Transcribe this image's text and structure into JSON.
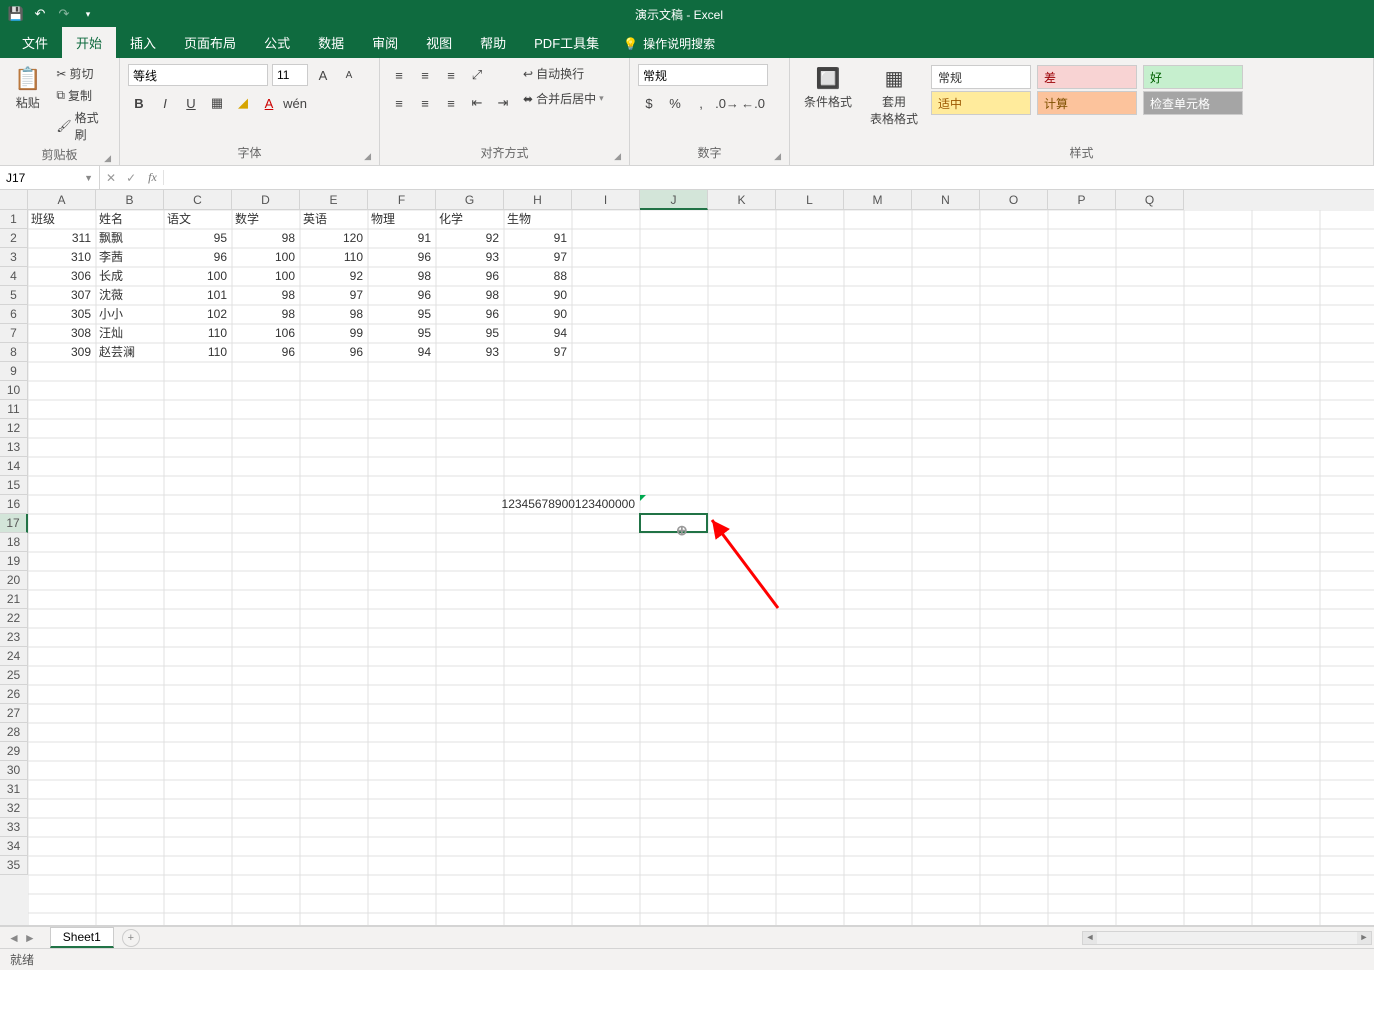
{
  "title": "演示文稿 - Excel",
  "qat": {
    "save": "save-icon",
    "undo": "undo-icon",
    "redo": "redo-icon"
  },
  "tabs": {
    "file": "文件",
    "home": "开始",
    "insert": "插入",
    "layout": "页面布局",
    "formulas": "公式",
    "data": "数据",
    "review": "审阅",
    "view": "视图",
    "help": "帮助",
    "pdf": "PDF工具集",
    "tellme": "操作说明搜索"
  },
  "ribbon": {
    "clipboard": {
      "label": "剪贴板",
      "paste": "粘贴",
      "cut": "剪切",
      "copy": "复制",
      "painter": "格式刷"
    },
    "font": {
      "label": "字体",
      "name": "等线",
      "size": "11"
    },
    "align": {
      "label": "对齐方式",
      "wrap": "自动换行",
      "merge": "合并后居中"
    },
    "number": {
      "label": "数字",
      "format": "常规"
    },
    "styles": {
      "label": "样式",
      "cond": "条件格式",
      "table": "套用\n表格格式",
      "normal": "常规",
      "bad": "差",
      "good": "好",
      "neutral": "适中",
      "calc": "计算",
      "check": "检查单元格"
    }
  },
  "namebox": "J17",
  "columns": [
    "A",
    "B",
    "C",
    "D",
    "E",
    "F",
    "G",
    "H",
    "I",
    "J",
    "K",
    "L",
    "M",
    "N",
    "O",
    "P",
    "Q"
  ],
  "rowcount": 35,
  "headers": [
    "班级",
    "姓名",
    "语文",
    "数学",
    "英语",
    "物理",
    "化学",
    "生物"
  ],
  "rows": [
    [
      311,
      "飘飘",
      95,
      98,
      120,
      91,
      92,
      91
    ],
    [
      310,
      "李茜",
      96,
      100,
      110,
      96,
      93,
      97
    ],
    [
      306,
      "长成",
      100,
      100,
      92,
      98,
      96,
      88
    ],
    [
      307,
      "沈薇",
      101,
      98,
      97,
      96,
      98,
      90
    ],
    [
      305,
      "小小",
      102,
      98,
      98,
      95,
      96,
      90
    ],
    [
      308,
      "汪灿",
      110,
      106,
      99,
      95,
      95,
      94
    ],
    [
      309,
      "赵芸澜",
      110,
      96,
      96,
      94,
      93,
      97
    ]
  ],
  "longcell": "12345678900123400000",
  "sheet": {
    "name": "Sheet1"
  },
  "status": "就绪"
}
